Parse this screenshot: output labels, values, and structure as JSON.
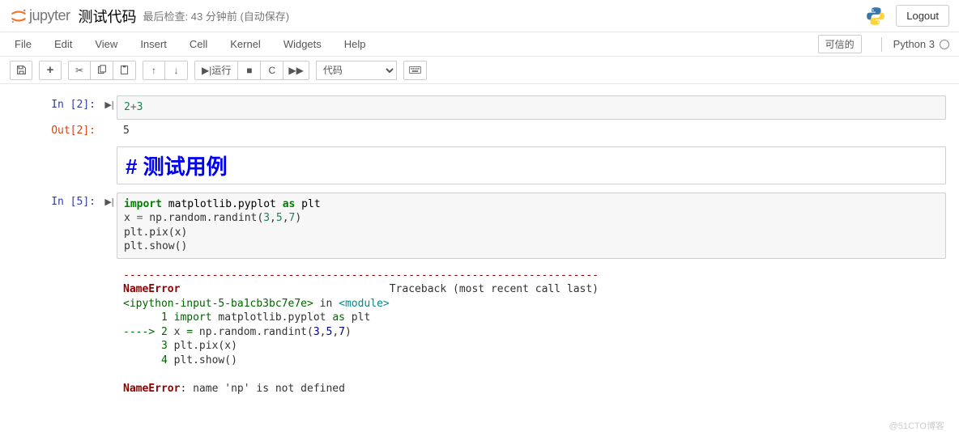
{
  "header": {
    "logo_text": "jupyter",
    "notebook_name": "测试代码",
    "checkpoint": "最后检查: 43 分钟前  (自动保存)",
    "logout": "Logout"
  },
  "menubar": {
    "items": [
      "File",
      "Edit",
      "View",
      "Insert",
      "Cell",
      "Kernel",
      "Widgets",
      "Help"
    ],
    "trusted": "可信的",
    "kernel": "Python 3"
  },
  "toolbar": {
    "run_label": "运行",
    "cell_type": "代码"
  },
  "cells": [
    {
      "in_prompt": "In  [2]:",
      "run_ind": "▶|",
      "code_html": "<span class='c-num'>2</span><span class='c-op'>+</span><span class='c-num'>3</span>",
      "out_prompt": "Out[2]:",
      "out_text": "5"
    },
    {
      "md_text": "# 测试用例"
    },
    {
      "in_prompt": "In  [5]:",
      "run_ind": "▶|",
      "code_html": "<span class='c-kw'>import</span> <span class='c-name'>matplotlib.pyplot</span> <span class='c-kw'>as</span> <span class='c-name'>plt</span>\nx <span class='c-op'>=</span> np.random.randint(<span class='c-num'>3</span>,<span class='c-num'>5</span>,<span class='c-num'>7</span>)\nplt.pix(x)\nplt.show()",
      "error_html": "<span class='ansi-red'>---------------------------------------------------------------------------</span>\n<span class='ansi-red-bold'>NameError</span>                                 Traceback (most recent call last)\n<span class='ansi-green'>&lt;ipython-input-5-ba1cb3bc7e7e&gt;</span> in <span class='ansi-cyan'>&lt;module&gt;</span>\n      <span class='ansi-green'>1</span> <span class='ansi-green'>import</span> matplotlib.pyplot <span class='ansi-green'>as</span> plt\n<span class='ansi-green'>----&gt; 2</span> x <span class='ansi-green'>=</span> np.random.randint(<span class='ansi-blue'>3</span>,<span class='ansi-blue'>5</span>,<span class='ansi-blue'>7</span>)\n      <span class='ansi-green'>3</span> plt.pix(x)\n      <span class='ansi-green'>4</span> plt.show()\n\n<span class='ansi-red-bold'>NameError</span>: name 'np' is not defined"
    }
  ],
  "watermark": "@51CTO博客"
}
